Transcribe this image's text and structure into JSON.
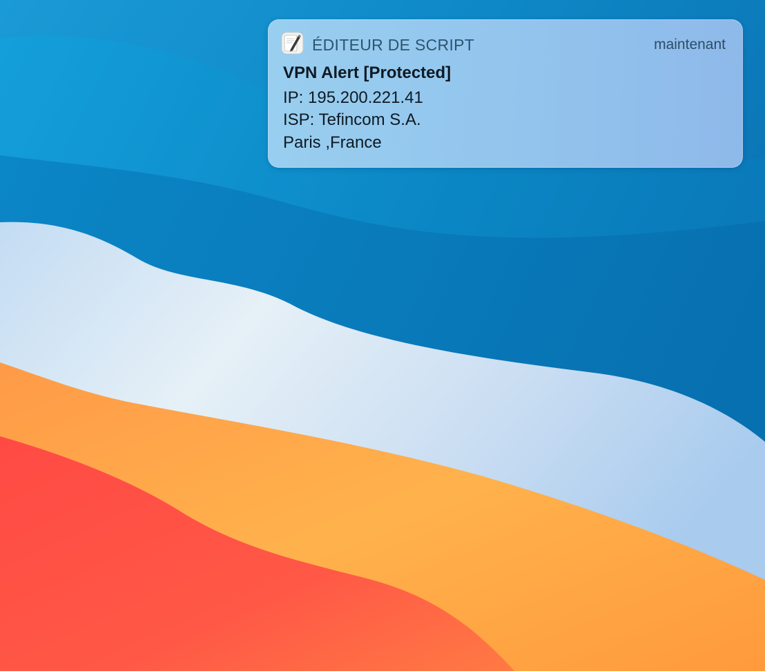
{
  "notification": {
    "app_name": "ÉDITEUR DE SCRIPT",
    "app_icon": "script-editor-icon",
    "timestamp": "maintenant",
    "title": "VPN Alert [Protected]",
    "body_lines": [
      "IP: 195.200.221.41",
      "ISP: Tefincom S.A.",
      "Paris ,France"
    ]
  },
  "wallpaper": {
    "name": "wallpaper",
    "colors": {
      "blue_dark": "#0a6fae",
      "blue_light": "#2a9fd8",
      "pale_blue": "#cfe3f5",
      "orange": "#ffa040",
      "red": "#ff4f45"
    }
  }
}
